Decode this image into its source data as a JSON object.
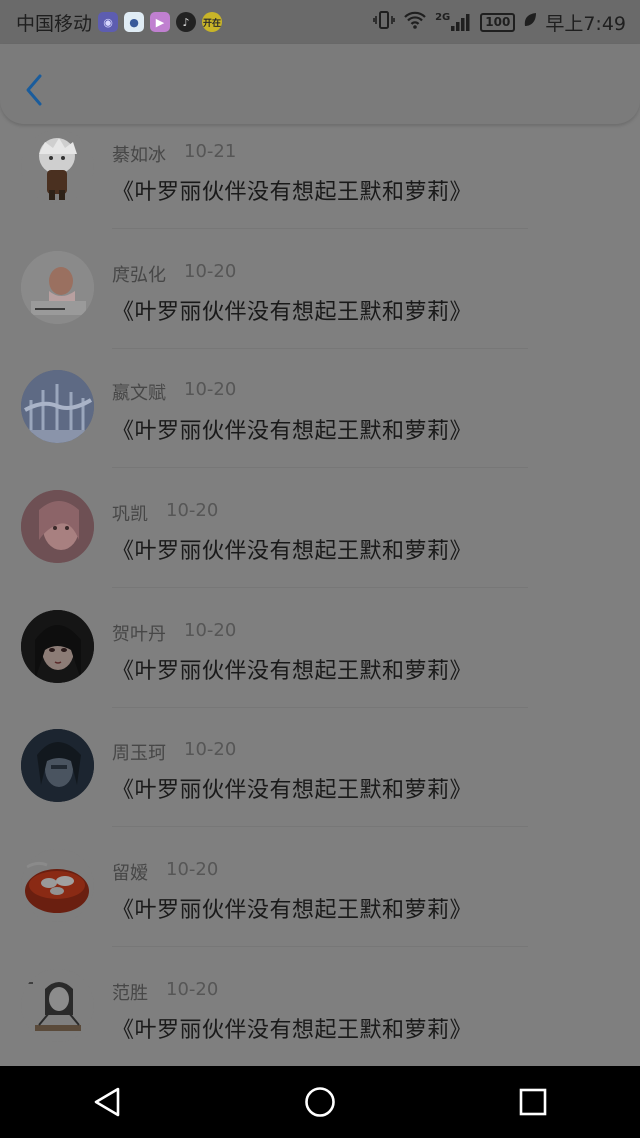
{
  "status_bar": {
    "carrier": "中国移动",
    "apps": [
      {
        "icon": "app-icon-swirl",
        "color": "#5d5db0",
        "glyph": "◉"
      },
      {
        "icon": "app-icon-circle",
        "color": "#e8f4ff",
        "glyph": "●"
      },
      {
        "icon": "app-icon-play",
        "color": "#f0c0ff",
        "glyph": "▶"
      },
      {
        "icon": "tiktok-icon",
        "color": "#202020",
        "glyph": "♪"
      },
      {
        "icon": "app-icon-yellow",
        "color": "#e6d22e",
        "glyph": "开"
      }
    ],
    "network": "2G",
    "battery": "100",
    "time": "早上7:49"
  },
  "header": {
    "back_icon": "chevron-left-icon",
    "accent": "#1a6bb5"
  },
  "items": [
    {
      "name": "綦如冰",
      "date": "10-21",
      "title": "《叶罗丽伙伴没有想起王默和萝莉》",
      "avatar": "avatar-chibi"
    },
    {
      "name": "庹弘化",
      "date": "10-20",
      "title": "《叶罗丽伙伴没有想起王默和萝莉》",
      "avatar": "avatar-girl-snow"
    },
    {
      "name": "嬴文赋",
      "date": "10-20",
      "title": "《叶罗丽伙伴没有想起王默和萝莉》",
      "avatar": "avatar-winter-trees"
    },
    {
      "name": "巩凯",
      "date": "10-20",
      "title": "《叶罗丽伙伴没有想起王默和萝莉》",
      "avatar": "avatar-pink-girl"
    },
    {
      "name": "贺叶丹",
      "date": "10-20",
      "title": "《叶罗丽伙伴没有想起王默和萝莉》",
      "avatar": "avatar-anime-girl"
    },
    {
      "name": "周玉珂",
      "date": "10-20",
      "title": "《叶罗丽伙伴没有想起王默和萝莉》",
      "avatar": "avatar-dark-portrait"
    },
    {
      "name": "留嫒",
      "date": "10-20",
      "title": "《叶罗丽伙伴没有想起王默和萝莉》",
      "avatar": "avatar-food-bowl"
    },
    {
      "name": "范胜",
      "date": "10-20",
      "title": "《叶罗丽伙伴没有想起王默和萝莉》",
      "avatar": "avatar-sketch-girl"
    }
  ],
  "nav": {
    "back": "triangle-back-icon",
    "home": "circle-home-icon",
    "recents": "square-recents-icon"
  }
}
